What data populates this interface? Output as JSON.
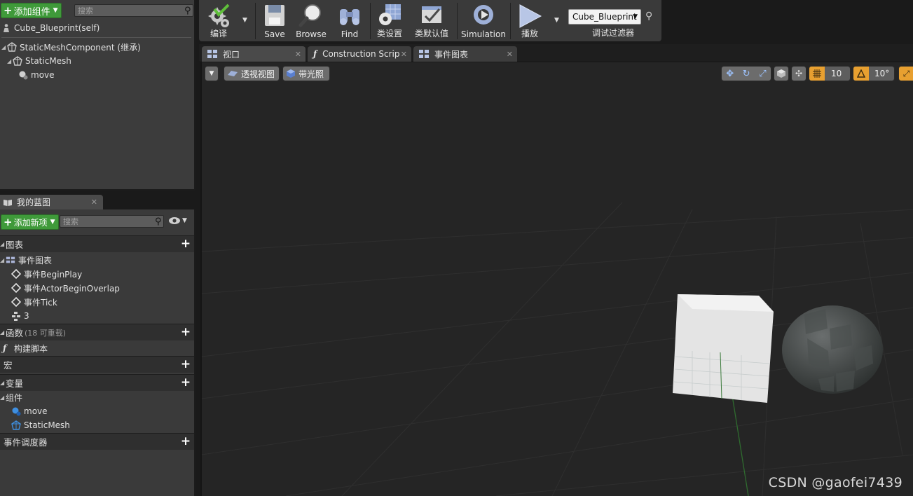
{
  "components": {
    "add_button": "添加组件",
    "search_placeholder": "搜索",
    "tree": [
      {
        "label": "Cube_Blueprint(self)"
      },
      {
        "label": "StaticMeshComponent (继承)"
      },
      {
        "label": "StaticMesh"
      },
      {
        "label": "move"
      }
    ]
  },
  "my_blueprint": {
    "tab_label": "我的蓝图",
    "add_button": "添加新项",
    "search_placeholder": "搜索",
    "graphs": {
      "header": "图表",
      "event_graph": "事件图表",
      "events": [
        "事件BeginPlay",
        "事件ActorBeginOverlap",
        "事件Tick"
      ],
      "extra": "3"
    },
    "functions": {
      "header": "函数",
      "sub": "(18 可重载)",
      "construction": "构建脚本"
    },
    "macros": {
      "header": "宏"
    },
    "variables": {
      "header": "变量",
      "group": "组件",
      "items": [
        "move",
        "StaticMesh"
      ]
    },
    "dispatchers": {
      "header": "事件调度器"
    }
  },
  "toolbar": {
    "compile": "编译",
    "save": "Save",
    "browse": "Browse",
    "find": "Find",
    "class_settings": "类设置",
    "class_defaults": "类默认值",
    "simulation": "Simulation",
    "play": "播放",
    "debug_value": "Cube_Blueprint",
    "debug_filter": "调试过滤器"
  },
  "tabs": [
    {
      "label": "视口"
    },
    {
      "label": "Construction Scrip"
    },
    {
      "label": "事件图表"
    }
  ],
  "viewport": {
    "perspective": "透视视图",
    "lit": "带光照",
    "grid_snap": "10",
    "rot_snap": "10°"
  },
  "watermark": "CSDN @gaofei7439",
  "colors": {
    "accent_green": "#3f9a3a",
    "panel": "#3a3a3a",
    "viewport": "#242424"
  }
}
